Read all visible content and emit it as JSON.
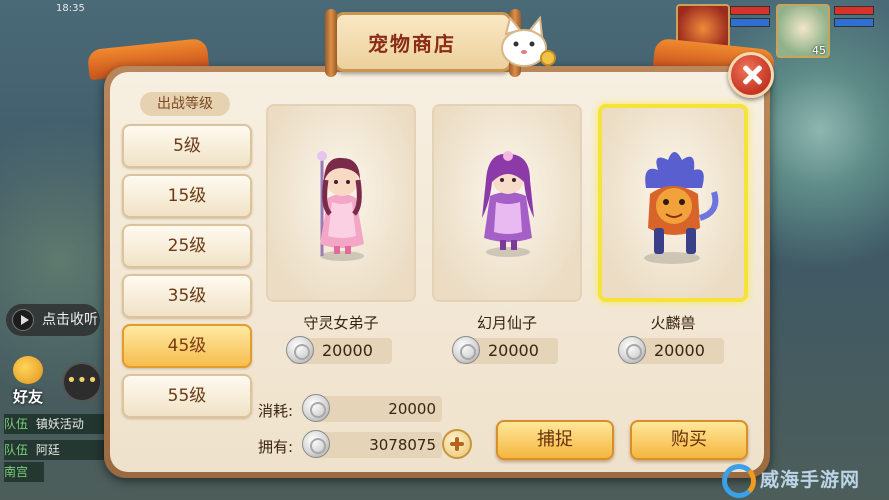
{
  "status_bar": {
    "time": "18:35"
  },
  "shop": {
    "title": "宠物商店",
    "level_header": "出战等级",
    "levels": [
      {
        "label": "5级",
        "active": false
      },
      {
        "label": "15级",
        "active": false
      },
      {
        "label": "25级",
        "active": false
      },
      {
        "label": "35级",
        "active": false
      },
      {
        "label": "45级",
        "active": true
      },
      {
        "label": "55级",
        "active": false
      }
    ],
    "pets": [
      {
        "name": "守灵女弟子",
        "price": "20000",
        "selected": false
      },
      {
        "name": "幻月仙子",
        "price": "20000",
        "selected": false
      },
      {
        "name": "火麟兽",
        "price": "20000",
        "selected": true
      }
    ],
    "cost_label": "消耗:",
    "cost_value": "20000",
    "owned_label": "拥有:",
    "owned_value": "3078075",
    "capture_button": "捕捉",
    "buy_button": "购买"
  },
  "background": {
    "chat_text": "点击收听",
    "friend_label": "好友",
    "team_rows": [
      {
        "tag": "队伍",
        "text": "镇妖活动"
      },
      {
        "tag": "队伍",
        "text": "阿廷"
      }
    ],
    "team_short": "南宫",
    "player_level": "45",
    "watermark": "威海手游网"
  },
  "colors": {
    "accent": "#f5b63f",
    "selected_border": "#f5e339",
    "close_red": "#c43623"
  }
}
